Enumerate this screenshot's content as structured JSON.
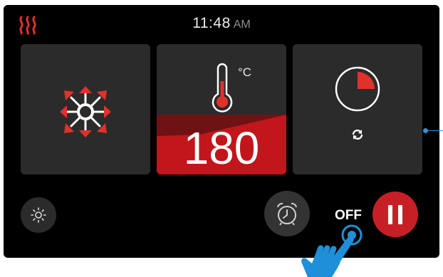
{
  "status_bar": {
    "time": "11:48",
    "ampm": "AM",
    "heating_icon": "heat-waves-icon"
  },
  "tiles": {
    "fan": {
      "icon": "convection-fan-icon"
    },
    "temperature": {
      "icon": "thermometer-icon",
      "unit": "°C",
      "value": "180"
    },
    "timer": {
      "icon": "timer-icon",
      "secondary_icon": "refresh-icon",
      "timer_progress": 0.25
    }
  },
  "controls": {
    "brightness_icon": "brightness-icon",
    "alarm_icon": "alarm-clock-icon",
    "off_label": "OFF",
    "pause_icon": "pause-icon"
  },
  "hint": {
    "icon": "touch-hand-icon"
  },
  "colors": {
    "accent_red": "#c62026",
    "touch_blue": "#1e8fd8"
  }
}
